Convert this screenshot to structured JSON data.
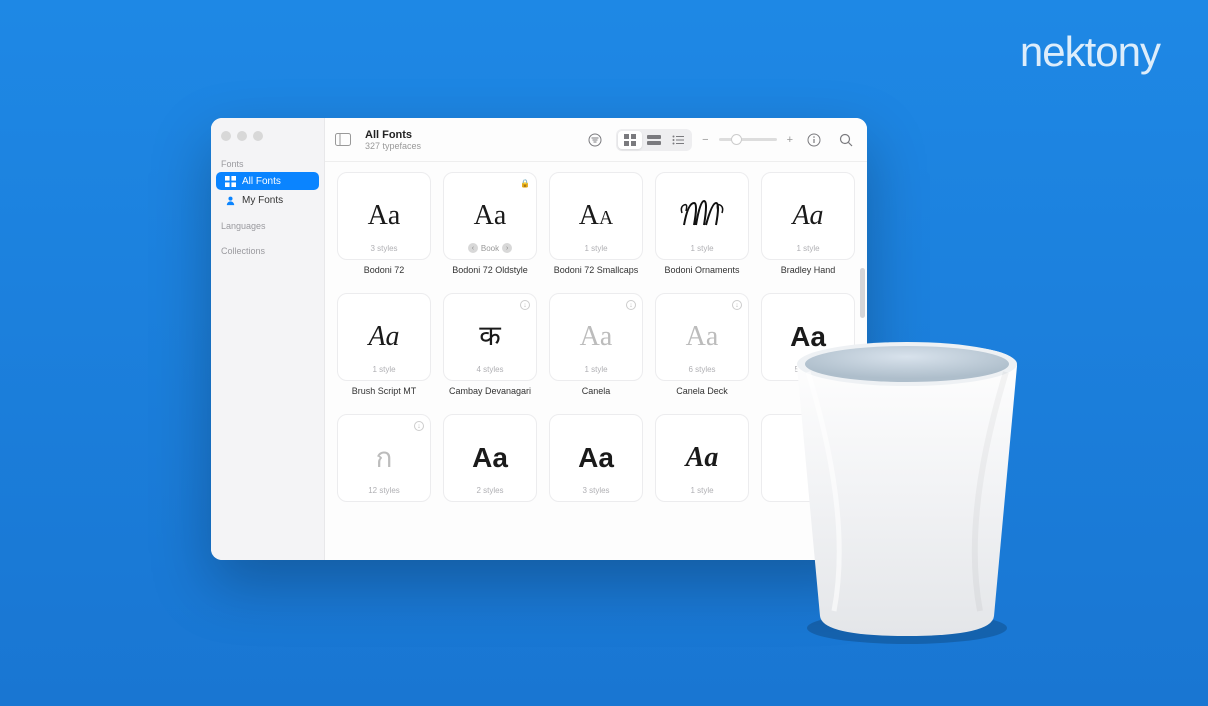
{
  "brand": "nektony",
  "header": {
    "title": "All Fonts",
    "subtitle": "327 typefaces"
  },
  "sidebar": {
    "sections": [
      "Fonts",
      "Languages",
      "Collections"
    ],
    "items": [
      {
        "label": "All Fonts",
        "active": true
      },
      {
        "label": "My Fonts",
        "active": false
      }
    ]
  },
  "fonts": [
    {
      "name": "Bodoni 72",
      "meta": "3 styles",
      "sample": "Aa",
      "style": "serif"
    },
    {
      "name": "Bodoni 72 Oldstyle",
      "meta": "Book",
      "sample": "Aa",
      "style": "serif",
      "locked": true,
      "pager": true
    },
    {
      "name": "Bodoni 72 Smallcaps",
      "meta": "1 style",
      "sample": "Aᴀ",
      "style": "smallcap"
    },
    {
      "name": "Bodoni Ornaments",
      "meta": "1 style",
      "sample": "orn",
      "style": "ornament"
    },
    {
      "name": "Bradley Hand",
      "meta": "1 style",
      "sample": "Aa",
      "style": "hand"
    },
    {
      "name": "Brush Script MT",
      "meta": "1 style",
      "sample": "Aa",
      "style": "script"
    },
    {
      "name": "Cambay Devanagari",
      "meta": "4 styles",
      "sample": "क",
      "style": "deva",
      "download": true
    },
    {
      "name": "Canela",
      "meta": "1 style",
      "sample": "Aa",
      "style": "gray",
      "download": true
    },
    {
      "name": "Canela Deck",
      "meta": "6 styles",
      "sample": "Aa",
      "style": "gray",
      "download": true
    },
    {
      "name": "",
      "meta": "5 styles",
      "sample": "Aa",
      "style": "sans"
    },
    {
      "name": "",
      "meta": "12 styles",
      "sample": "ก",
      "style": "thai",
      "download": true
    },
    {
      "name": "",
      "meta": "2 styles",
      "sample": "Aa",
      "style": "sans"
    },
    {
      "name": "",
      "meta": "3 styles",
      "sample": "Aa",
      "style": "sans"
    },
    {
      "name": "",
      "meta": "1 style",
      "sample": "Aa",
      "style": "hand2"
    },
    {
      "name": "",
      "meta": "",
      "sample": "",
      "style": ""
    }
  ],
  "slider_label_minus": "−",
  "slider_label_plus": "+"
}
